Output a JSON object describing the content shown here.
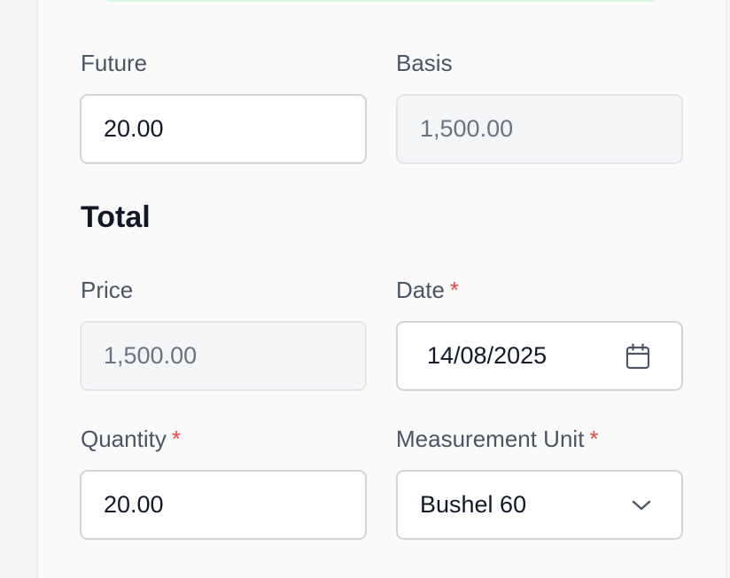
{
  "form": {
    "future": {
      "label": "Future",
      "value": "20.00"
    },
    "basis": {
      "label": "Basis",
      "value": "1,500.00"
    },
    "total_title": "Total",
    "price": {
      "label": "Price",
      "value": "1,500.00"
    },
    "date": {
      "label": "Date",
      "required_mark": "*",
      "value": "14/08/2025",
      "icon": "calendar-icon"
    },
    "quantity": {
      "label": "Quantity",
      "required_mark": "*",
      "value": "20.00"
    },
    "measurement_unit": {
      "label": "Measurement Unit",
      "required_mark": "*",
      "value": "Bushel 60",
      "icon": "chevron-down-icon"
    }
  },
  "colors": {
    "required": "#ef4444",
    "label": "#4b5563",
    "input_border": "#d1d5db",
    "readonly_bg": "#f4f5f7"
  }
}
